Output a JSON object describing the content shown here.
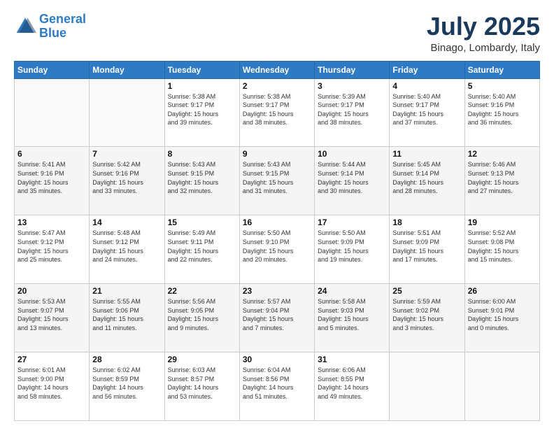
{
  "header": {
    "logo_line1": "General",
    "logo_line2": "Blue",
    "month": "July 2025",
    "location": "Binago, Lombardy, Italy"
  },
  "weekdays": [
    "Sunday",
    "Monday",
    "Tuesday",
    "Wednesday",
    "Thursday",
    "Friday",
    "Saturday"
  ],
  "rows": [
    [
      {
        "day": "",
        "info": ""
      },
      {
        "day": "",
        "info": ""
      },
      {
        "day": "1",
        "info": "Sunrise: 5:38 AM\nSunset: 9:17 PM\nDaylight: 15 hours\nand 39 minutes."
      },
      {
        "day": "2",
        "info": "Sunrise: 5:38 AM\nSunset: 9:17 PM\nDaylight: 15 hours\nand 38 minutes."
      },
      {
        "day": "3",
        "info": "Sunrise: 5:39 AM\nSunset: 9:17 PM\nDaylight: 15 hours\nand 38 minutes."
      },
      {
        "day": "4",
        "info": "Sunrise: 5:40 AM\nSunset: 9:17 PM\nDaylight: 15 hours\nand 37 minutes."
      },
      {
        "day": "5",
        "info": "Sunrise: 5:40 AM\nSunset: 9:16 PM\nDaylight: 15 hours\nand 36 minutes."
      }
    ],
    [
      {
        "day": "6",
        "info": "Sunrise: 5:41 AM\nSunset: 9:16 PM\nDaylight: 15 hours\nand 35 minutes."
      },
      {
        "day": "7",
        "info": "Sunrise: 5:42 AM\nSunset: 9:16 PM\nDaylight: 15 hours\nand 33 minutes."
      },
      {
        "day": "8",
        "info": "Sunrise: 5:43 AM\nSunset: 9:15 PM\nDaylight: 15 hours\nand 32 minutes."
      },
      {
        "day": "9",
        "info": "Sunrise: 5:43 AM\nSunset: 9:15 PM\nDaylight: 15 hours\nand 31 minutes."
      },
      {
        "day": "10",
        "info": "Sunrise: 5:44 AM\nSunset: 9:14 PM\nDaylight: 15 hours\nand 30 minutes."
      },
      {
        "day": "11",
        "info": "Sunrise: 5:45 AM\nSunset: 9:14 PM\nDaylight: 15 hours\nand 28 minutes."
      },
      {
        "day": "12",
        "info": "Sunrise: 5:46 AM\nSunset: 9:13 PM\nDaylight: 15 hours\nand 27 minutes."
      }
    ],
    [
      {
        "day": "13",
        "info": "Sunrise: 5:47 AM\nSunset: 9:12 PM\nDaylight: 15 hours\nand 25 minutes."
      },
      {
        "day": "14",
        "info": "Sunrise: 5:48 AM\nSunset: 9:12 PM\nDaylight: 15 hours\nand 24 minutes."
      },
      {
        "day": "15",
        "info": "Sunrise: 5:49 AM\nSunset: 9:11 PM\nDaylight: 15 hours\nand 22 minutes."
      },
      {
        "day": "16",
        "info": "Sunrise: 5:50 AM\nSunset: 9:10 PM\nDaylight: 15 hours\nand 20 minutes."
      },
      {
        "day": "17",
        "info": "Sunrise: 5:50 AM\nSunset: 9:09 PM\nDaylight: 15 hours\nand 19 minutes."
      },
      {
        "day": "18",
        "info": "Sunrise: 5:51 AM\nSunset: 9:09 PM\nDaylight: 15 hours\nand 17 minutes."
      },
      {
        "day": "19",
        "info": "Sunrise: 5:52 AM\nSunset: 9:08 PM\nDaylight: 15 hours\nand 15 minutes."
      }
    ],
    [
      {
        "day": "20",
        "info": "Sunrise: 5:53 AM\nSunset: 9:07 PM\nDaylight: 15 hours\nand 13 minutes."
      },
      {
        "day": "21",
        "info": "Sunrise: 5:55 AM\nSunset: 9:06 PM\nDaylight: 15 hours\nand 11 minutes."
      },
      {
        "day": "22",
        "info": "Sunrise: 5:56 AM\nSunset: 9:05 PM\nDaylight: 15 hours\nand 9 minutes."
      },
      {
        "day": "23",
        "info": "Sunrise: 5:57 AM\nSunset: 9:04 PM\nDaylight: 15 hours\nand 7 minutes."
      },
      {
        "day": "24",
        "info": "Sunrise: 5:58 AM\nSunset: 9:03 PM\nDaylight: 15 hours\nand 5 minutes."
      },
      {
        "day": "25",
        "info": "Sunrise: 5:59 AM\nSunset: 9:02 PM\nDaylight: 15 hours\nand 3 minutes."
      },
      {
        "day": "26",
        "info": "Sunrise: 6:00 AM\nSunset: 9:01 PM\nDaylight: 15 hours\nand 0 minutes."
      }
    ],
    [
      {
        "day": "27",
        "info": "Sunrise: 6:01 AM\nSunset: 9:00 PM\nDaylight: 14 hours\nand 58 minutes."
      },
      {
        "day": "28",
        "info": "Sunrise: 6:02 AM\nSunset: 8:59 PM\nDaylight: 14 hours\nand 56 minutes."
      },
      {
        "day": "29",
        "info": "Sunrise: 6:03 AM\nSunset: 8:57 PM\nDaylight: 14 hours\nand 53 minutes."
      },
      {
        "day": "30",
        "info": "Sunrise: 6:04 AM\nSunset: 8:56 PM\nDaylight: 14 hours\nand 51 minutes."
      },
      {
        "day": "31",
        "info": "Sunrise: 6:06 AM\nSunset: 8:55 PM\nDaylight: 14 hours\nand 49 minutes."
      },
      {
        "day": "",
        "info": ""
      },
      {
        "day": "",
        "info": ""
      }
    ]
  ]
}
